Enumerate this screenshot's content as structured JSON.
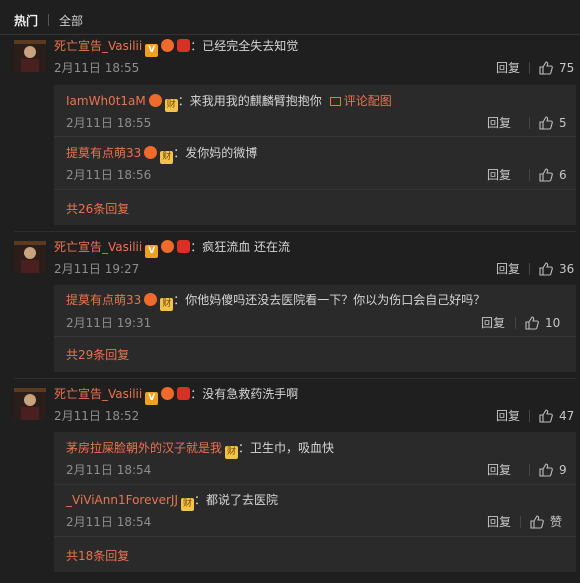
{
  "tabs": {
    "hot": "热门",
    "all": "全部"
  },
  "comments": [
    {
      "name": "死亡宣告_Vasilii",
      "text": "：已经完全失去知觉",
      "time": "2月11日 18:55",
      "reply": "回复",
      "likes": "75",
      "replies": [
        {
          "name": "IamWh0t1aM",
          "text": "：来我用我的麒麟臂抱抱你",
          "pic": "评论配图",
          "time": "2月11日 18:55",
          "reply": "回复",
          "likes": "5"
        },
        {
          "name": "提莫有点萌33",
          "text": "：发你妈的微博",
          "time": "2月11日 18:56",
          "reply": "回复",
          "likes": "6"
        }
      ],
      "more": "共26条回复"
    },
    {
      "name": "死亡宣告_Vasilii",
      "text": "：疯狂流血 还在流",
      "time": "2月11日 19:27",
      "reply": "回复",
      "likes": "36",
      "replies": [
        {
          "name": "提莫有点萌33",
          "text": "：你他妈傻吗还没去医院看一下？你以为伤口会自己好吗？",
          "time": "2月11日 19:31",
          "reply": "回复",
          "likes": "10"
        }
      ],
      "more": "共29条回复"
    },
    {
      "name": "死亡宣告_Vasilii",
      "text": "：没有急救药洗手啊",
      "time": "2月11日 18:52",
      "reply": "回复",
      "likes": "47",
      "replies": [
        {
          "name": "茅房拉屎脸朝外的汉子就是我",
          "text": "：卫生巾，吸血快",
          "time": "2月11日 18:54",
          "reply": "回复",
          "likes": "9"
        },
        {
          "name": "_ViViAnn1ForeverJJ",
          "text": "：都说了去医院",
          "time": "2月11日 18:54",
          "reply": "回复",
          "likes": "赞"
        }
      ],
      "more": "共18条回复"
    }
  ],
  "badges": {
    "v": "V",
    "cai": "财"
  },
  "colors": {
    "name": "#eb7350",
    "background": "#1f1f1f",
    "reply_box": "#2a2a2a"
  },
  "icons": [
    "thumbs-up-icon",
    "vip-badge-icon",
    "pig-badge-icon",
    "heart-badge-icon",
    "cai-badge-icon",
    "image-icon"
  ]
}
